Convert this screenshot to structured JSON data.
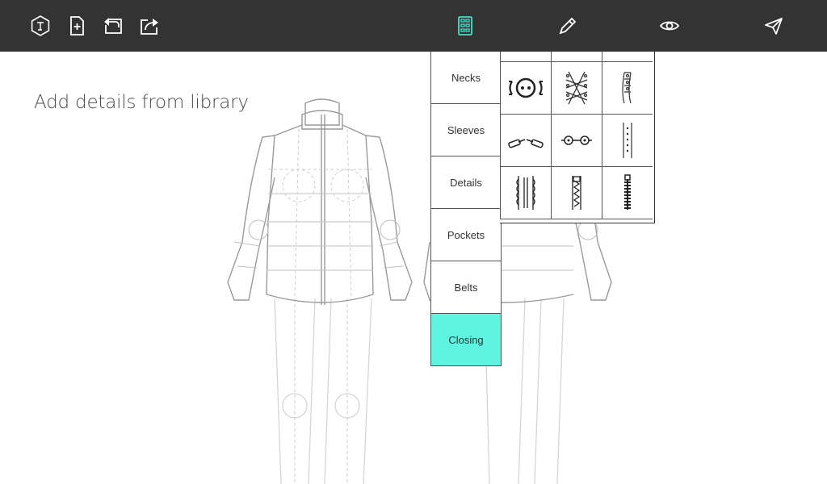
{
  "toolbar": {
    "left_icons": [
      "logo-icon",
      "new-file-icon",
      "undo-icon",
      "share-icon"
    ],
    "center_icons": [
      "library-icon",
      "pencil-icon",
      "eye-icon"
    ],
    "right_icons": [
      "send-icon"
    ],
    "active_color": "#3ee0c8",
    "icon_color": "#ffffff"
  },
  "canvas": {
    "hint": "Add details from library"
  },
  "library": {
    "categories": [
      {
        "label": "Necks"
      },
      {
        "label": "Sleeves"
      },
      {
        "label": "Details"
      },
      {
        "label": "Pockets"
      },
      {
        "label": "Belts"
      },
      {
        "label": "Closing"
      }
    ],
    "active_category": "Closing",
    "active_color": "#5ef4e0",
    "items": [
      "button-toggle-icon",
      "lacing-icon",
      "snap-laces-icon",
      "toggle-pair-icon",
      "buttons-pair-icon",
      "button-strip-icon",
      "ruffle-zip-icon",
      "zipper-icon",
      "heavy-zipper-icon"
    ]
  }
}
